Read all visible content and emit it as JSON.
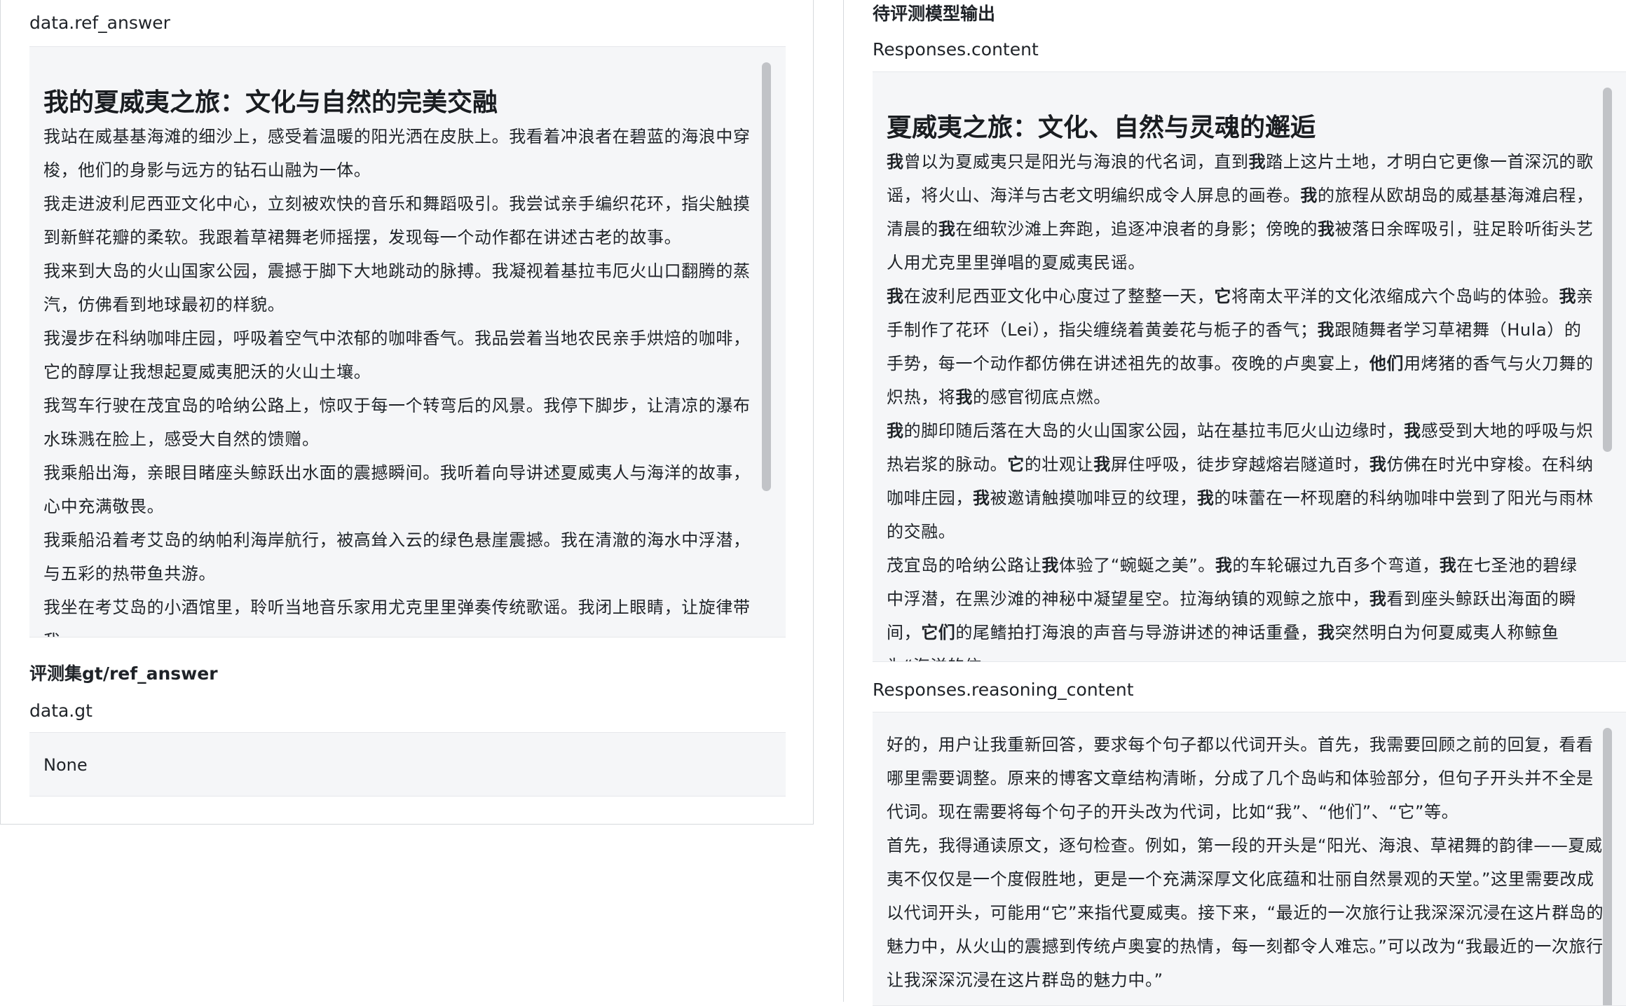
{
  "left": {
    "ref_answer_label": "data.ref_answer",
    "ref_title": "我的夏威夷之旅：文化与自然的完美交融",
    "ref_paragraphs": [
      "我站在威基基海滩的细沙上，感受着温暖的阳光洒在皮肤上。我看着冲浪者在碧蓝的海浪中穿梭，他们的身影与远方的钻石山融为一体。",
      "我走进波利尼西亚文化中心，立刻被欢快的音乐和舞蹈吸引。我尝试亲手编织花环，指尖触摸到新鲜花瓣的柔软。我跟着草裙舞老师摇摆，发现每一个动作都在讲述古老的故事。",
      "我来到大岛的火山国家公园，震撼于脚下大地跳动的脉搏。我凝视着基拉韦厄火山口翻腾的蒸汽，仿佛看到地球最初的样貌。",
      "我漫步在科纳咖啡庄园，呼吸着空气中浓郁的咖啡香气。我品尝着当地农民亲手烘焙的咖啡，它的醇厚让我想起夏威夷肥沃的火山土壤。",
      "我驾车行驶在茂宜岛的哈纳公路上，惊叹于每一个转弯后的风景。我停下脚步，让清凉的瀑布水珠溅在脸上，感受大自然的馈赠。",
      "我乘船出海，亲眼目睹座头鲸跃出水面的震撼瞬间。我听着向导讲述夏威夷人与海洋的故事，心中充满敬畏。",
      "我乘船沿着考艾岛的纳帕利海岸航行，被高耸入云的绿色悬崖震撼。我在清澈的海水中浮潜，与五彩的热带鱼共游。",
      "我坐在考艾岛的小酒馆里，聆听当地音乐家用尤克里里弹奏传统歌谣。我闭上眼睛，让旋律带我"
    ],
    "gt_section_title": "评测集gt/ref_answer",
    "gt_label": "data.gt",
    "gt_value": "None"
  },
  "right": {
    "section_title": "待评测模型输出",
    "content_label": "Responses.content",
    "content_title": "夏威夷之旅：文化、自然与灵魂的邂逅",
    "content_paragraphs_html": [
      "<b>我</b>曾以为夏威夷只是阳光与海浪的代名词，直到<b>我</b>踏上这片土地，才明白它更像一首深沉的歌谣，将火山、海洋与古老文明编织成令人屏息的画卷。<b>我</b>的旅程从欧胡岛的威基基海滩启程，清晨的<b>我</b>在细软沙滩上奔跑，追逐冲浪者的身影；傍晚的<b>我</b>被落日余晖吸引，驻足聆听街头艺人用尤克里里弹唱的夏威夷民谣。",
      "<b>我</b>在波利尼西亚文化中心度过了整整一天，<b>它</b>将南太平洋的文化浓缩成六个岛屿的体验。<b>我</b>亲手制作了花环（Lei），指尖缠绕着黄姜花与栀子的香气；<b>我</b>跟随舞者学习草裙舞（Hula）的手势，每一个动作都仿佛在讲述祖先的故事。夜晚的卢奥宴上，<b>他们</b>用烤猪的香气与火刀舞的炽热，将<b>我</b>的感官彻底点燃。",
      "<b>我</b>的脚印随后落在大岛的火山国家公园，站在基拉韦厄火山边缘时，<b>我</b>感受到大地的呼吸与炽热岩浆的脉动。<b>它</b>的壮观让<b>我</b>屏住呼吸，徒步穿越熔岩隧道时，<b>我</b>仿佛在时光中穿梭。在科纳咖啡庄园，<b>我</b>被邀请触摸咖啡豆的纹理，<b>我</b>的味蕾在一杯现磨的科纳咖啡中尝到了阳光与雨林的交融。",
      "茂宜岛的哈纳公路让<b>我</b>体验了“蜿蜒之美”。<b>我</b>的车轮碾过九百多个弯道，<b>我</b>在七圣池的碧绿中浮潜，在黑沙滩的神秘中凝望星空。拉海纳镇的观鲸之旅中，<b>我</b>看到座头鲸跃出海面的瞬间，<b>它们</b>的尾鳍拍打海浪的声音与导游讲述的神话重叠，<b>我</b>突然明白为何夏威夷人称鲸鱼为“海洋的信"
    ],
    "reasoning_label": "Responses.reasoning_content",
    "reasoning_paragraphs": [
      "好的，用户让我重新回答，要求每个句子都以代词开头。首先，我需要回顾之前的回复，看看哪里需要调整。原来的博客文章结构清晰，分成了几个岛屿和体验部分，但句子开头并不全是代词。现在需要将每个句子的开头改为代词，比如“我”、“他们”、“它”等。",
      "首先，我得通读原文，逐句检查。例如，第一段的开头是“阳光、海浪、草裙舞的韵律——夏威夷不仅仅是一个度假胜地，更是一个充满深厚文化底蕴和壮丽自然景观的天堂。”这里需要改成以代词开头，可能用“它”来指代夏威夷。接下来，“最近的一次旅行让我深深沉浸在这片群岛的魅力中，从火山的震撼到传统卢奥宴的热情，每一刻都令人难忘。”可以改为“我最近的一次旅行让我深深沉浸在这片群岛的魅力中。”"
    ]
  }
}
